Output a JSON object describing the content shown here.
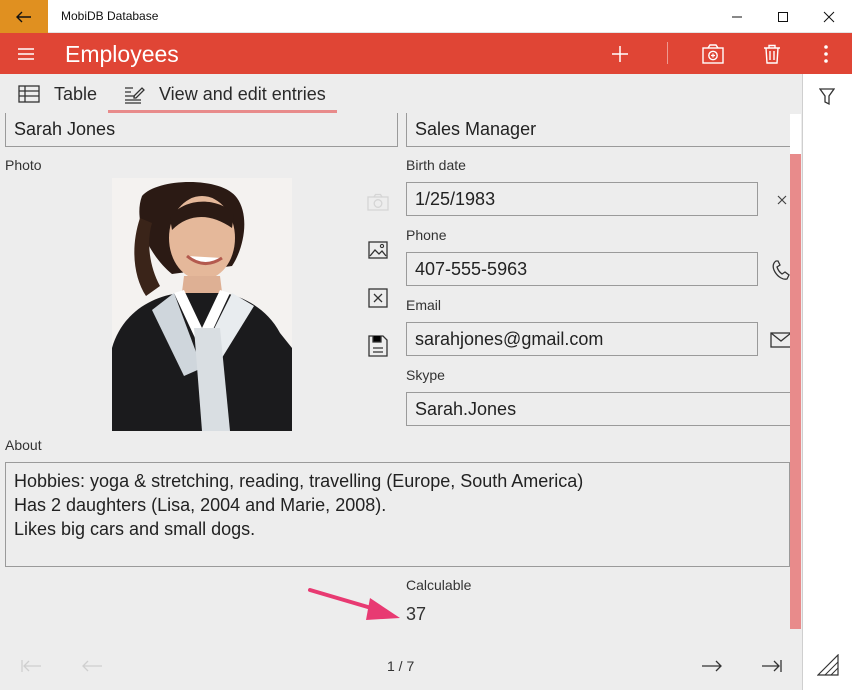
{
  "window": {
    "title": "MobiDB Database",
    "accent_color": "#e09020",
    "icons": {
      "back": "arrow-left-icon",
      "minimize": "minimize-icon",
      "maximize": "maximize-icon",
      "close": "close-icon"
    }
  },
  "appbar": {
    "title": "Employees",
    "color": "#e04535",
    "icons": {
      "menu": "hamburger-menu-icon",
      "add": "plus-icon",
      "camera": "camera-record-icon",
      "delete": "trash-icon",
      "more": "more-vertical-icon"
    }
  },
  "tabs": [
    {
      "label": "Table",
      "icon": "table-icon",
      "selected": false
    },
    {
      "label": "View and edit entries",
      "icon": "edit-form-icon",
      "selected": true
    }
  ],
  "form": {
    "name_value": "Sarah Jones",
    "position_value": "Sales Manager",
    "photo_label": "Photo",
    "photo_icons": [
      "camera-icon",
      "image-icon",
      "clear-image-icon",
      "save-image-icon"
    ],
    "birth_date_label": "Birth date",
    "birth_date_value": "1/25/1983",
    "phone_label": "Phone",
    "phone_value": "407-555-5963",
    "email_label": "Email",
    "email_value": "sarahjones@gmail.com",
    "skype_label": "Skype",
    "skype_value": "Sarah.Jones",
    "about_label": "About",
    "about_lines": [
      "Hobbies: yoga & stretching, reading, travelling (Europe, South America)",
      "Has 2 daughters (Lisa, 2004 and Marie, 2008).",
      "Likes big cars and small dogs."
    ],
    "calculable_label": "Calculable",
    "calculable_value": "37",
    "highlight_color": "#e83a72"
  },
  "pager": {
    "text": "1 / 7",
    "icons": [
      "first-page-icon",
      "previous-page-icon",
      "next-page-icon",
      "last-page-icon"
    ]
  },
  "right_panel": {
    "icons": [
      "filter-icon",
      "resize-grip-icon"
    ]
  },
  "scrollbar_color": "#e88b8b"
}
